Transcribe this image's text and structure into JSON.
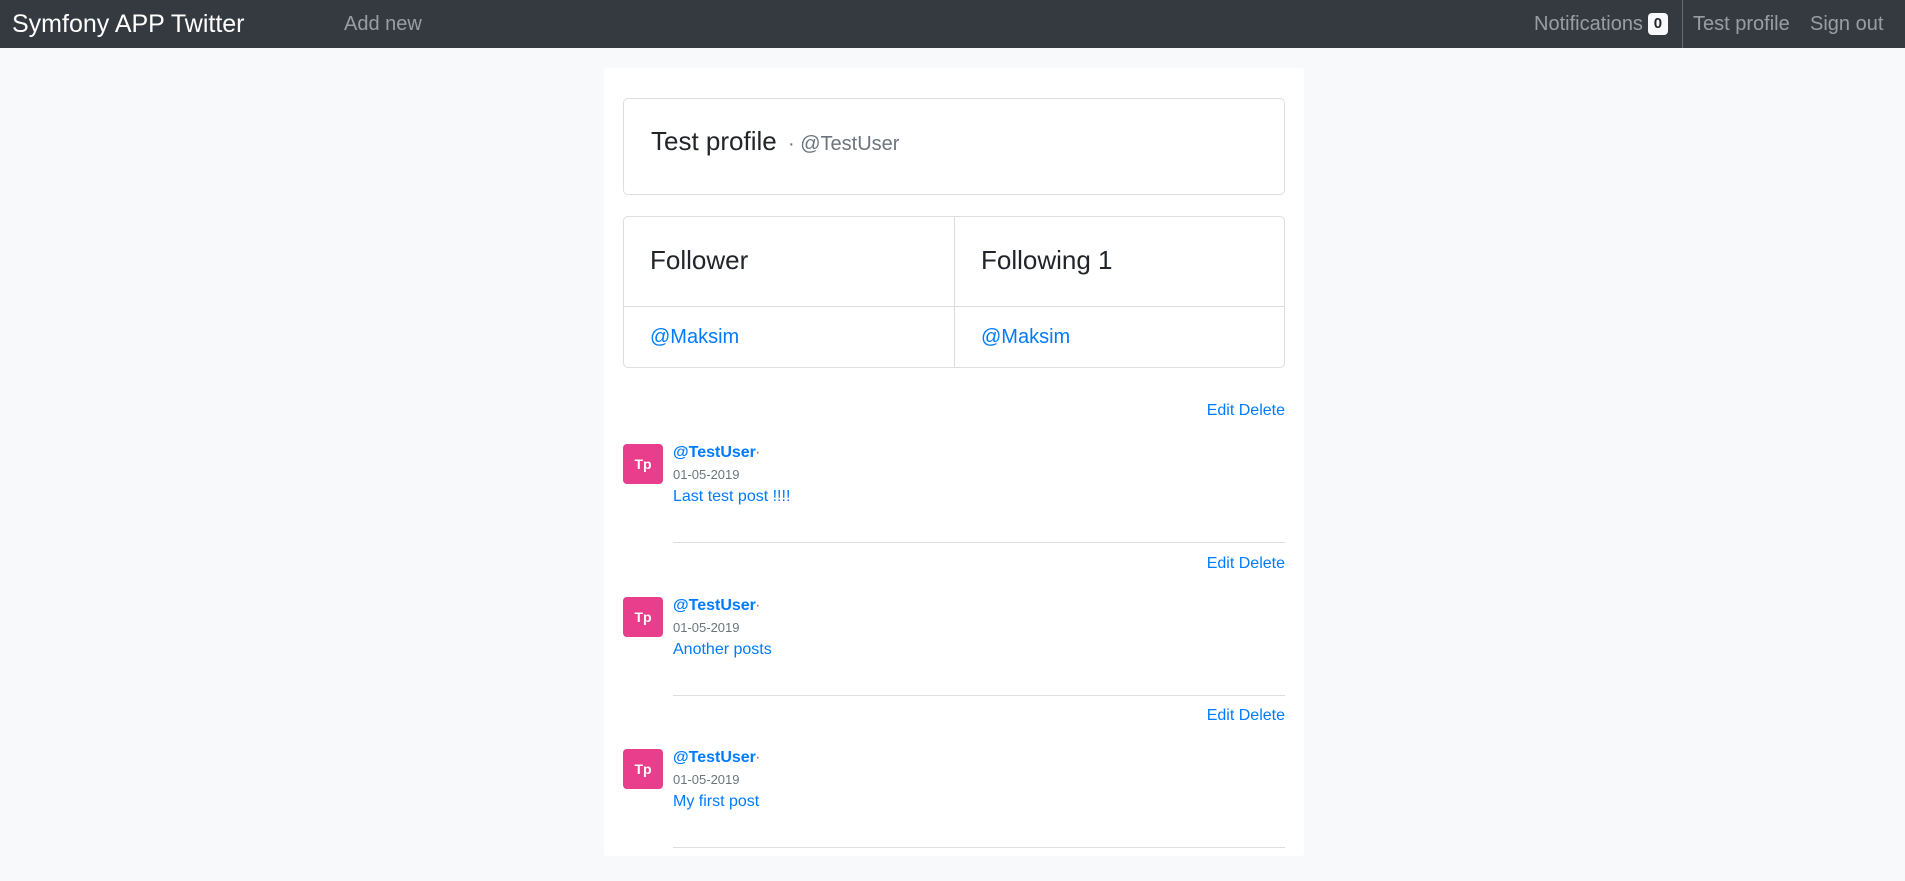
{
  "navbar": {
    "brand": "Symfony APP Twitter",
    "add_new": "Add new",
    "notifications_label": "Notifications",
    "notifications_count": "0",
    "profile": "Test profile",
    "sign_out": "Sign out"
  },
  "profile": {
    "name": "Test profile",
    "handle": "· @TestUser"
  },
  "follow": {
    "follower_title": "Follower",
    "follower_user": "@Maksim",
    "following_title": "Following 1",
    "following_user": "@Maksim"
  },
  "posts": [
    {
      "edit": "Edit",
      "delete": "Delete",
      "avatar": "Tp",
      "author": "@TestUser",
      "separator": "·",
      "date": "01-05-2019",
      "text": "Last test post !!!!"
    },
    {
      "edit": "Edit",
      "delete": "Delete",
      "avatar": "Tp",
      "author": "@TestUser",
      "separator": "·",
      "date": "01-05-2019",
      "text": "Another posts"
    },
    {
      "edit": "Edit",
      "delete": "Delete",
      "avatar": "Tp",
      "author": "@TestUser",
      "separator": "·",
      "date": "01-05-2019",
      "text": "My first post"
    }
  ],
  "colors": {
    "navbar_bg": "#343a40",
    "link": "#007bff",
    "avatar_bg": "#e83e8c",
    "page_bg": "#f8f9fa"
  }
}
